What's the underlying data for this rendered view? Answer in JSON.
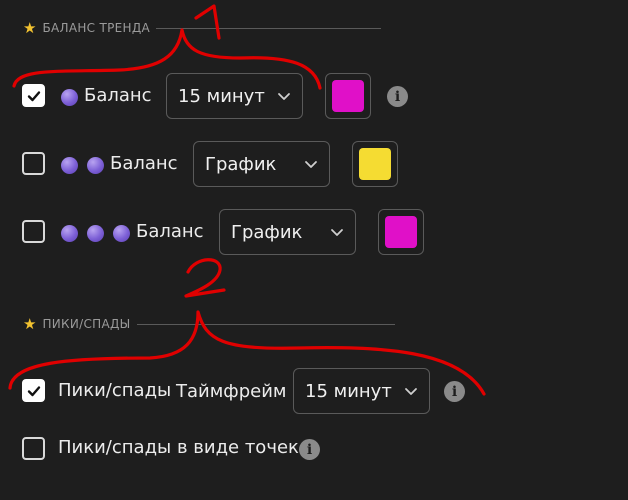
{
  "section1": {
    "title": "БАЛАНС ТРЕНДА"
  },
  "rows1": [
    {
      "checked": true,
      "dots": 1,
      "label": "Баланс",
      "select": "15 минут",
      "color": "#e010c8"
    },
    {
      "checked": false,
      "dots": 2,
      "label": "Баланс",
      "select": "График",
      "color": "#f5dc32"
    },
    {
      "checked": false,
      "dots": 3,
      "label": "Баланс",
      "select": "График",
      "color": "#e010c8"
    }
  ],
  "section2": {
    "title": "ПИКИ/СПАДЫ"
  },
  "peaks": {
    "label": "Пики/спады",
    "checked": true,
    "timeframe_label": "Таймфрейм",
    "timeframe_value": "15 минут"
  },
  "peaks_dots": {
    "label": "Пики/спады в виде точек",
    "checked": false
  },
  "annotations": {
    "mark1": "1",
    "mark2": "2",
    "color": "#e00000"
  },
  "icons": {
    "star": "star-icon",
    "check": "check-icon",
    "chevron": "chevron-down-icon",
    "info": "info-icon",
    "dot": "purple-dot-icon"
  }
}
